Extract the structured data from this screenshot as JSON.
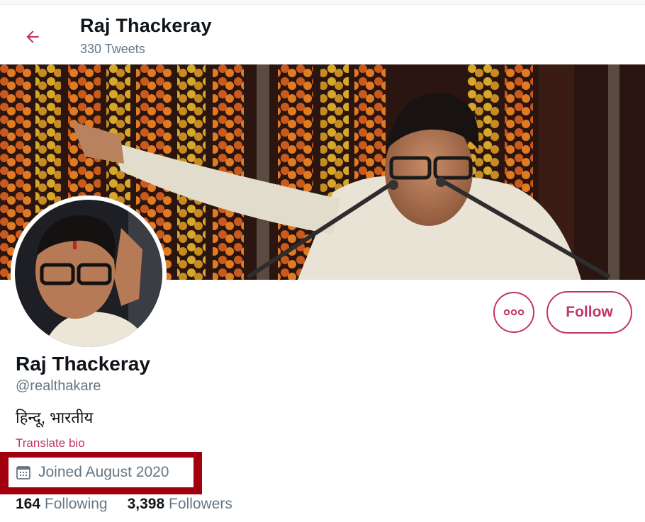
{
  "header": {
    "name": "Raj Thackeray",
    "tweet_count": "330 Tweets"
  },
  "profile": {
    "name": "Raj Thackeray",
    "handle": "@realthakare",
    "bio": "हिन्दू, भारतीय",
    "translate_label": "Translate bio",
    "joined": "Joined August 2020",
    "following_count": "164",
    "following_label": "Following",
    "followers_count": "3,398",
    "followers_label": "Followers"
  },
  "actions": {
    "more_label": "•••",
    "follow_label": "Follow"
  },
  "colors": {
    "accent": "#c0356b",
    "highlight_box": "#a3000f",
    "muted_text": "#657786"
  },
  "icons": [
    "back-arrow-icon",
    "more-options-icon",
    "calendar-icon"
  ]
}
